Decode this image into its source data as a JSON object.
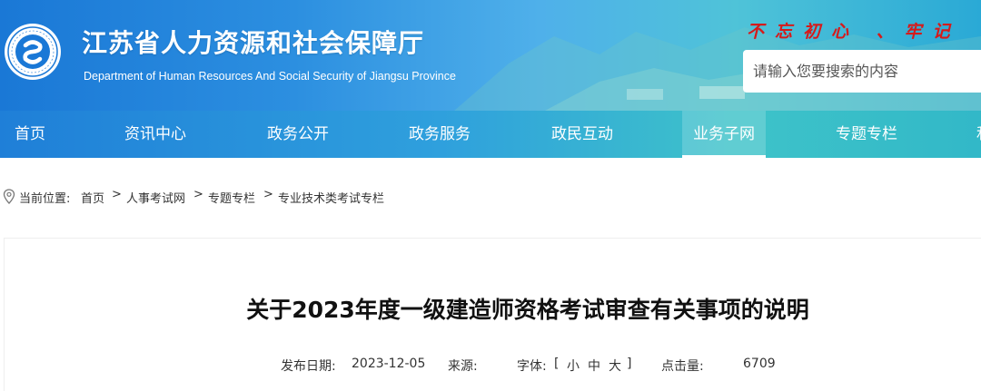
{
  "header": {
    "title": "江苏省人力资源和社会保障厅",
    "subtitle": "Department of Human Resources And Social Security of Jiangsu Province",
    "slogan": "不忘初心  、牢记",
    "search_placeholder": "请输入您要搜索的内容",
    "logo_icon": "jiangsu-hrss-emblem"
  },
  "nav": {
    "items": [
      {
        "label": "首页"
      },
      {
        "label": "资讯中心"
      },
      {
        "label": "政务公开"
      },
      {
        "label": "政务服务"
      },
      {
        "label": "政民互动"
      },
      {
        "label": "业务子网"
      },
      {
        "label": "专题专栏"
      },
      {
        "label": "和"
      }
    ],
    "active_index": 5
  },
  "breadcrumb": {
    "prefix": "当前位置:",
    "parts": [
      "首页",
      "人事考试网",
      "专题专栏",
      "专业技术类考试专栏"
    ],
    "separator": ">"
  },
  "article": {
    "title": "关于2023年度一级建造师资格考试审查有关事项的说明",
    "publish_label": "发布日期:",
    "publish_date": "2023-12-05",
    "source_label": "来源:",
    "source_value": "",
    "font_label": "字体:",
    "font_open": "[",
    "font_small": "小",
    "font_medium": "中",
    "font_large": "大",
    "font_close": "]",
    "views_label": "点击量:",
    "views_value": "6709"
  },
  "colors": {
    "header_start": "#1a78d6",
    "header_end": "#2aa9d6",
    "slogan": "#d61a1a"
  }
}
